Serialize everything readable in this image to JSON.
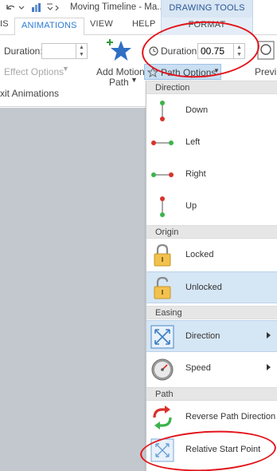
{
  "titlebar": {
    "title": "Moving Timeline - Ma...",
    "context_header": "DRAWING TOOLS"
  },
  "tabs": [
    {
      "label": "IS"
    },
    {
      "label": "ANIMATIONS"
    },
    {
      "label": "VIEW"
    },
    {
      "label": "HELP"
    },
    {
      "label": "FORMAT"
    }
  ],
  "ribbon": {
    "duration_label_left": "Duration:",
    "duration_value_left": "",
    "effect_options_label": "Effect Options",
    "exit_animations_label": "xit Animations",
    "add_motion_path_line1": "Add Motion",
    "add_motion_path_line2": "Path",
    "duration_label_right": "Duration:",
    "duration_value_right": "00.75",
    "path_options_label": "Path Options",
    "preview_label": "Previ"
  },
  "menu": {
    "sections": [
      {
        "label": "Direction"
      },
      {
        "label": "Origin"
      },
      {
        "label": "Easing"
      },
      {
        "label": "Path"
      }
    ],
    "items": [
      {
        "label": "Down",
        "icon": "path-down-icon"
      },
      {
        "label": "Left",
        "icon": "path-left-icon"
      },
      {
        "label": "Right",
        "icon": "path-right-icon"
      },
      {
        "label": "Up",
        "icon": "path-up-icon"
      },
      {
        "label": "Locked",
        "icon": "lock-closed-icon"
      },
      {
        "label": "Unlocked",
        "icon": "lock-open-icon"
      },
      {
        "label": "Direction",
        "icon": "easing-direction-icon"
      },
      {
        "label": "Speed",
        "icon": "speed-gauge-icon"
      },
      {
        "label": "Reverse Path Direction",
        "icon": "reverse-path-icon"
      },
      {
        "label": "Relative Start Point",
        "icon": "relative-start-icon"
      }
    ]
  },
  "colors": {
    "accent_tab": "#2b7cd3",
    "annotation_red": "#e2151c",
    "menu_highlight": "#d5e6f5",
    "canvas_gray": "#c3c8cf"
  }
}
